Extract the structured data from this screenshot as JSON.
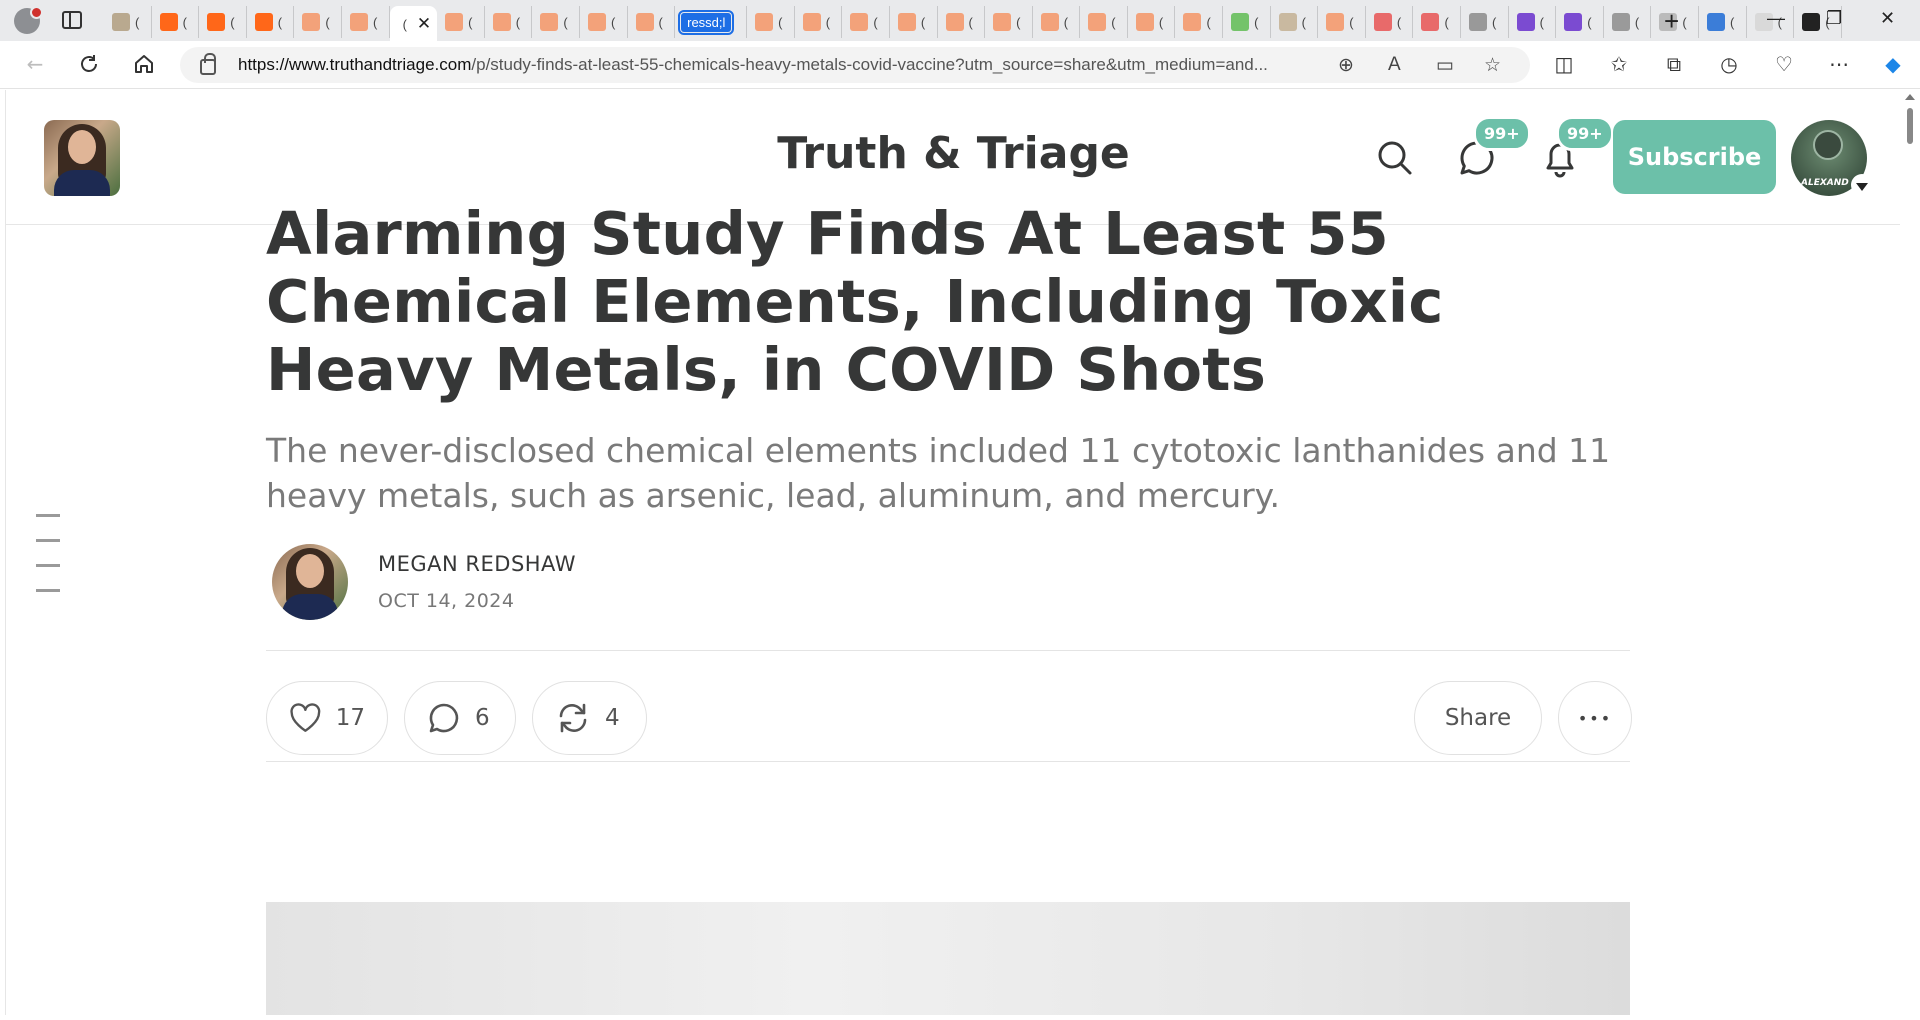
{
  "browser": {
    "tab_badge_text": "ressd;l",
    "tab_paren": "(",
    "close_glyph": "✕",
    "new_tab_glyph": "+",
    "url_domain": "https://www.truthandtriage.com",
    "url_path": "/p/study-finds-at-least-55-chemicals-heavy-metals-covid-vaccine?utm_source=share&utm_medium=and...",
    "tab_favicon_colors": [
      "#b9a98f",
      "#ff6719",
      "#ff6719",
      "#ff6719",
      "#f3a27a",
      "#f3a27a",
      "#f3a27a",
      "#f3a27a",
      "#f3a27a",
      "#f3a27a",
      "#f3a27a",
      "#f3a27a",
      "#f3a27a",
      "#f3a27a",
      "#f3a27a",
      "#f3a27a",
      "#f3a27a",
      "#f3a27a",
      "#f3a27a",
      "#f3a27a",
      "#f3a27a",
      "#74c36a",
      "#c9b9a0",
      "#f3a27a",
      "#e86a6a",
      "#e86a6a",
      "#999999",
      "#7b4bd1",
      "#7b4bd1",
      "#9a9a9a",
      "#bbbbbb",
      "#3b7dd8",
      "#d9d9d9",
      "#222222"
    ]
  },
  "publication": {
    "name": "Truth & Triage",
    "subscribe_label": "Subscribe",
    "chat_badge": "99+",
    "bell_badge": "99+",
    "user_avatar_text": "ALEXAND",
    "accent_color": "#6cc0a9"
  },
  "article": {
    "title": "Alarming Study Finds At Least 55 Chemical Elements, Including Toxic Heavy Metals, in COVID Shots",
    "subtitle": "The never-disclosed chemical elements included 11 cytotoxic lanthanides and 11 heavy metals, such as arsenic, lead, aluminum, and mercury.",
    "author": "MEGAN REDSHAW",
    "date": "OCT 14, 2024",
    "likes": "17",
    "comments": "6",
    "restacks": "4",
    "share_label": "Share",
    "more_glyph": "•••"
  }
}
